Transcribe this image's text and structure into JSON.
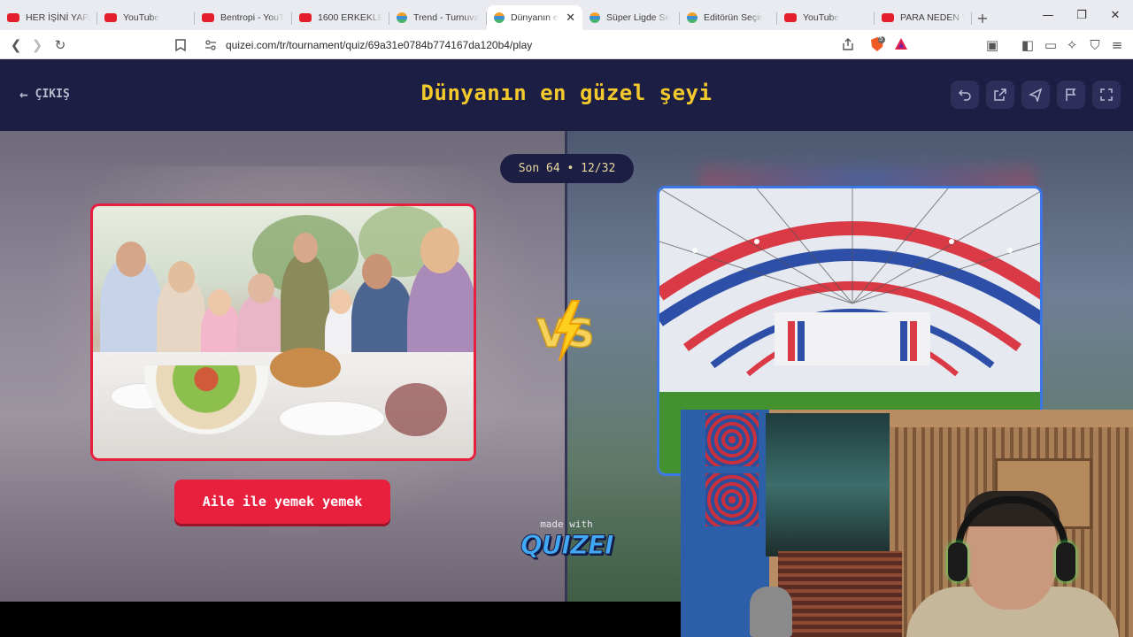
{
  "browser": {
    "tabs": [
      {
        "title": "HER İŞİNİ YAPAN",
        "icon": "youtube-icon",
        "active": false
      },
      {
        "title": "YouTube",
        "icon": "youtube-icon",
        "active": false
      },
      {
        "title": "Bentropi - YouT",
        "icon": "youtube-icon",
        "active": false
      },
      {
        "title": "1600 ERKEKLE B",
        "icon": "youtube-icon",
        "active": false
      },
      {
        "title": "Trend - Turnuva",
        "icon": "quizei-icon",
        "active": false
      },
      {
        "title": "Dünyanın e",
        "icon": "quizei-icon",
        "active": true
      },
      {
        "title": "Süper Ligde Se",
        "icon": "quizei-icon",
        "active": false
      },
      {
        "title": "Editörün Seçin",
        "icon": "quizei-icon",
        "active": false
      },
      {
        "title": "YouTube",
        "icon": "youtube-icon",
        "active": false
      },
      {
        "title": "PARA NEDEN V",
        "icon": "youtube-icon",
        "active": false
      }
    ],
    "url": "quizei.com/tr/tournament/quiz/69a31e0784b774167da120b4/play",
    "brave_shield_count": "5"
  },
  "header": {
    "exit_label": "ÇIKIŞ",
    "title": "Dünyanın en güzel şeyi"
  },
  "round": {
    "label": "Son 64 • 12/32"
  },
  "choices": {
    "left_label": "Aile ile yemek yemek"
  },
  "branding": {
    "made_with": "made with",
    "brand": "QUIZEI"
  },
  "colors": {
    "accent_yellow": "#f3c92b",
    "left_red": "#e8203e",
    "right_blue": "#3b78e6",
    "bg_navy": "#1d1e44"
  }
}
